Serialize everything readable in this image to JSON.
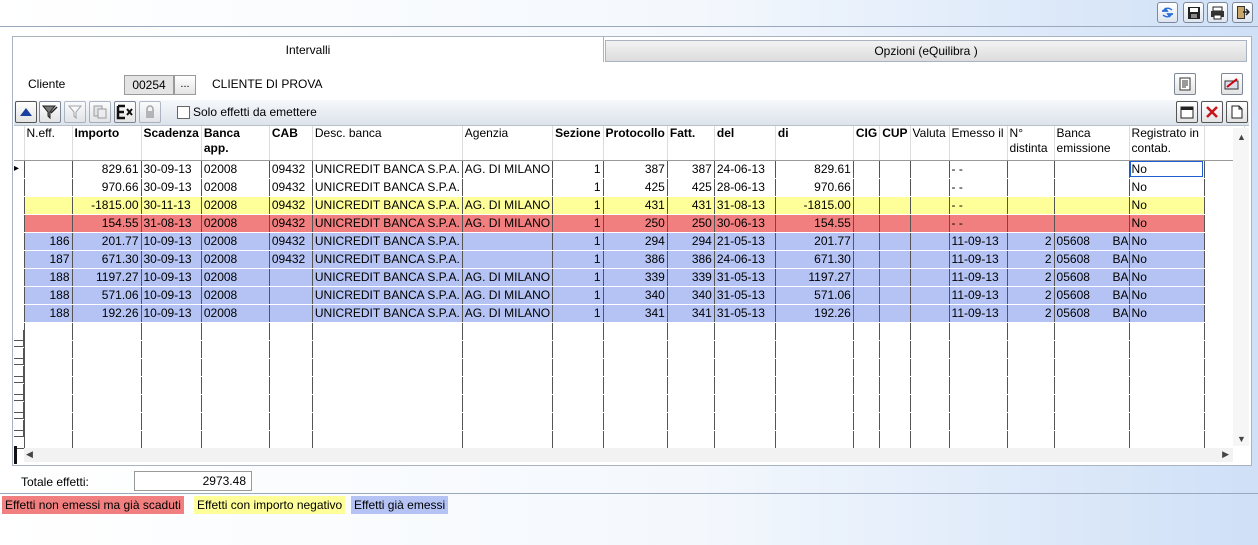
{
  "toolbar_top": {
    "icons": [
      "refresh-icon",
      "save-icon",
      "print-icon",
      "exit-icon"
    ]
  },
  "tabs": [
    {
      "label": "Intervalli",
      "active": true
    },
    {
      "label": "Opzioni (eQuilibra )",
      "active": false
    }
  ],
  "cliente": {
    "label": "Cliente",
    "code": "00254",
    "browse_label": "...",
    "name": "CLIENTE DI PROVA"
  },
  "filter": {
    "checkbox_label": "Solo effetti da emettere",
    "checked": false
  },
  "columns": [
    "N.eff.",
    "Importo",
    "Scadenza",
    "Banca app.",
    "CAB",
    "Desc. banca",
    "Agenzia",
    "Sezione",
    "Protocollo",
    "Fatt.",
    "del",
    "di",
    "CIG",
    "CUP",
    "Valuta",
    "Emesso il",
    "N° distinta",
    "Banca emissione",
    "Registrato in contab."
  ],
  "rows": [
    {
      "neff": "",
      "importo": "829.61",
      "scadenza": "30-09-13",
      "banca": "02008",
      "cab": "09432",
      "desc": "UNICREDIT BANCA S.P.A.",
      "agenzia": "AG. DI MILANO",
      "sezione": "1",
      "protocollo": "387",
      "fatt": "387",
      "del": "24-06-13",
      "di": "829.61",
      "emesso": "- -",
      "distinta": "",
      "banca_em": "",
      "banca_em2": "",
      "reg": "No",
      "color": "#ffffff",
      "current": true
    },
    {
      "neff": "",
      "importo": "970.66",
      "scadenza": "30-09-13",
      "banca": "02008",
      "cab": "09432",
      "desc": "UNICREDIT BANCA S.P.A.",
      "agenzia": "",
      "sezione": "1",
      "protocollo": "425",
      "fatt": "425",
      "del": "28-06-13",
      "di": "970.66",
      "emesso": "- -",
      "distinta": "",
      "banca_em": "",
      "banca_em2": "",
      "reg": "No",
      "color": "#ffffff"
    },
    {
      "neff": "",
      "importo": "-1815.00",
      "scadenza": "30-11-13",
      "banca": "02008",
      "cab": "09432",
      "desc": "UNICREDIT BANCA S.P.A.",
      "agenzia": "AG. DI MILANO",
      "sezione": "1",
      "protocollo": "431",
      "fatt": "431",
      "del": "31-08-13",
      "di": "-1815.00",
      "emesso": "- -",
      "distinta": "",
      "banca_em": "",
      "banca_em2": "",
      "reg": "No",
      "color": "#ffff99"
    },
    {
      "neff": "",
      "importo": "154.55",
      "scadenza": "31-08-13",
      "banca": "02008",
      "cab": "09432",
      "desc": "UNICREDIT BANCA S.P.A.",
      "agenzia": "AG. DI MILANO",
      "sezione": "1",
      "protocollo": "250",
      "fatt": "250",
      "del": "30-06-13",
      "di": "154.55",
      "emesso": "- -",
      "distinta": "",
      "banca_em": "",
      "banca_em2": "",
      "reg": "No",
      "color": "#f27f7f"
    },
    {
      "neff": "186",
      "importo": "201.77",
      "scadenza": "10-09-13",
      "banca": "02008",
      "cab": "09432",
      "desc": "UNICREDIT BANCA S.P.A.",
      "agenzia": "",
      "sezione": "1",
      "protocollo": "294",
      "fatt": "294",
      "del": "21-05-13",
      "di": "201.77",
      "emesso": "11-09-13",
      "distinta": "2",
      "banca_em": "05608",
      "banca_em2": "BA",
      "reg": "No",
      "color": "#b4c3f3"
    },
    {
      "neff": "187",
      "importo": "671.30",
      "scadenza": "30-09-13",
      "banca": "02008",
      "cab": "09432",
      "desc": "UNICREDIT BANCA S.P.A.",
      "agenzia": "",
      "sezione": "1",
      "protocollo": "386",
      "fatt": "386",
      "del": "24-06-13",
      "di": "671.30",
      "emesso": "11-09-13",
      "distinta": "2",
      "banca_em": "05608",
      "banca_em2": "BA",
      "reg": "No",
      "color": "#b4c3f3"
    },
    {
      "neff": "188",
      "importo": "1197.27",
      "scadenza": "10-09-13",
      "banca": "02008",
      "cab": "",
      "desc": "UNICREDIT BANCA S.P.A.",
      "agenzia": "AG. DI MILANO",
      "sezione": "1",
      "protocollo": "339",
      "fatt": "339",
      "del": "31-05-13",
      "di": "1197.27",
      "emesso": "11-09-13",
      "distinta": "2",
      "banca_em": "05608",
      "banca_em2": "BA",
      "reg": "No",
      "color": "#b4c3f3"
    },
    {
      "neff": "188",
      "importo": "571.06",
      "scadenza": "10-09-13",
      "banca": "02008",
      "cab": "",
      "desc": "UNICREDIT BANCA S.P.A.",
      "agenzia": "AG. DI MILANO",
      "sezione": "1",
      "protocollo": "340",
      "fatt": "340",
      "del": "31-05-13",
      "di": "571.06",
      "emesso": "11-09-13",
      "distinta": "2",
      "banca_em": "05608",
      "banca_em2": "BA",
      "reg": "No",
      "color": "#b4c3f3"
    },
    {
      "neff": "188",
      "importo": "192.26",
      "scadenza": "10-09-13",
      "banca": "02008",
      "cab": "",
      "desc": "UNICREDIT BANCA S.P.A.",
      "agenzia": "AG. DI MILANO",
      "sezione": "1",
      "protocollo": "341",
      "fatt": "341",
      "del": "31-05-13",
      "di": "192.26",
      "emesso": "11-09-13",
      "distinta": "2",
      "banca_em": "05608",
      "banca_em2": "BA",
      "reg": "No",
      "color": "#b4c3f3"
    }
  ],
  "totale": {
    "label": "Totale effetti:",
    "value": "2973.48"
  },
  "legend": [
    {
      "label": "Effetti non emessi ma già scaduti",
      "color": "#f27f7f"
    },
    {
      "label": "Effetti con importo negativo",
      "color": "#ffff99"
    },
    {
      "label": "Effetti già emessi",
      "color": "#b4c3f3"
    }
  ]
}
